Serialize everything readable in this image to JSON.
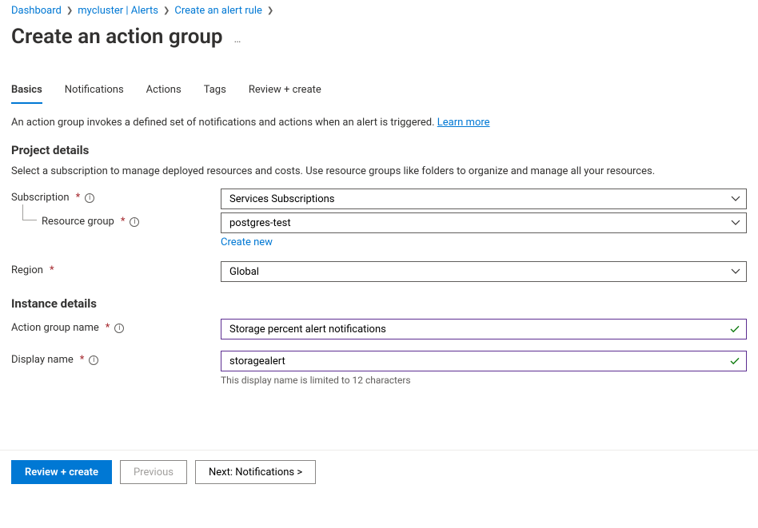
{
  "breadcrumb": {
    "items": [
      "Dashboard",
      "mycluster | Alerts",
      "Create an alert rule"
    ]
  },
  "title": "Create an action group",
  "tabs": {
    "items": [
      "Basics",
      "Notifications",
      "Actions",
      "Tags",
      "Review + create"
    ],
    "activeIndex": 0
  },
  "description": "An action group invokes a defined set of notifications and actions when an alert is triggered.",
  "learn_more": "Learn more",
  "sections": {
    "project": {
      "heading": "Project details",
      "sub": "Select a subscription to manage deployed resources and costs. Use resource groups like folders to organize and manage all your resources.",
      "subscription": {
        "label": "Subscription",
        "value": "Services Subscriptions"
      },
      "resource_group": {
        "label": "Resource group",
        "value": "postgres-test",
        "create_new": "Create new"
      },
      "region": {
        "label": "Region",
        "value": "Global"
      }
    },
    "instance": {
      "heading": "Instance details",
      "action_group_name": {
        "label": "Action group name",
        "value": "Storage percent alert notifications"
      },
      "display_name": {
        "label": "Display name",
        "value": "storagealert",
        "hint": "This display name is limited to 12 characters"
      }
    }
  },
  "footer": {
    "review": "Review + create",
    "previous": "Previous",
    "next": "Next: Notifications >"
  }
}
